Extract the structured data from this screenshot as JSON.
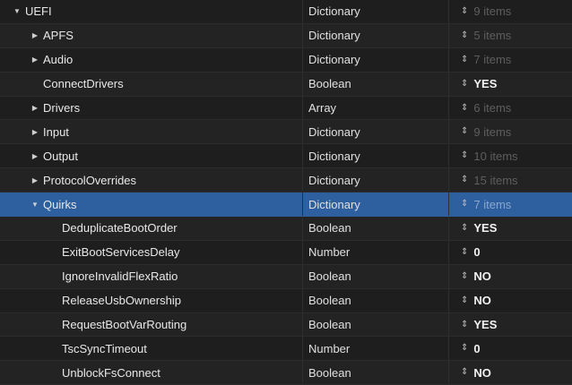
{
  "rows": [
    {
      "key": "UEFI",
      "disclosure": "▼",
      "type": "Dictionary",
      "value": "9 items",
      "value_style": "dim"
    },
    {
      "key": "APFS",
      "disclosure": "▶",
      "type": "Dictionary",
      "value": "5 items",
      "value_style": "dim"
    },
    {
      "key": "Audio",
      "disclosure": "▶",
      "type": "Dictionary",
      "value": "7 items",
      "value_style": "dim"
    },
    {
      "key": "ConnectDrivers",
      "disclosure": "",
      "type": "Boolean",
      "value": "YES",
      "value_style": "strong"
    },
    {
      "key": "Drivers",
      "disclosure": "▶",
      "type": "Array",
      "value": "6 items",
      "value_style": "dim"
    },
    {
      "key": "Input",
      "disclosure": "▶",
      "type": "Dictionary",
      "value": "9 items",
      "value_style": "dim"
    },
    {
      "key": "Output",
      "disclosure": "▶",
      "type": "Dictionary",
      "value": "10 items",
      "value_style": "dim"
    },
    {
      "key": "ProtocolOverrides",
      "disclosure": "▶",
      "type": "Dictionary",
      "value": "15 items",
      "value_style": "dim"
    },
    {
      "key": "Quirks",
      "disclosure": "▼",
      "type": "Dictionary",
      "value": "7 items",
      "value_style": "dim",
      "selected": true
    },
    {
      "key": "DeduplicateBootOrder",
      "disclosure": "",
      "type": "Boolean",
      "value": "YES",
      "value_style": "strong"
    },
    {
      "key": "ExitBootServicesDelay",
      "disclosure": "",
      "type": "Number",
      "value": "0",
      "value_style": "strong"
    },
    {
      "key": "IgnoreInvalidFlexRatio",
      "disclosure": "",
      "type": "Boolean",
      "value": "NO",
      "value_style": "strong"
    },
    {
      "key": "ReleaseUsbOwnership",
      "disclosure": "",
      "type": "Boolean",
      "value": "NO",
      "value_style": "strong"
    },
    {
      "key": "RequestBootVarRouting",
      "disclosure": "",
      "type": "Boolean",
      "value": "YES",
      "value_style": "strong"
    },
    {
      "key": "TscSyncTimeout",
      "disclosure": "",
      "type": "Number",
      "value": "0",
      "value_style": "strong"
    },
    {
      "key": "UnblockFsConnect",
      "disclosure": "",
      "type": "Boolean",
      "value": "NO",
      "value_style": "strong"
    }
  ],
  "stepper_glyph": "⇕",
  "colors": {
    "background": "#1e1e1e",
    "selection": "#2e5f9e",
    "dim_value": "#5e5e5e"
  }
}
